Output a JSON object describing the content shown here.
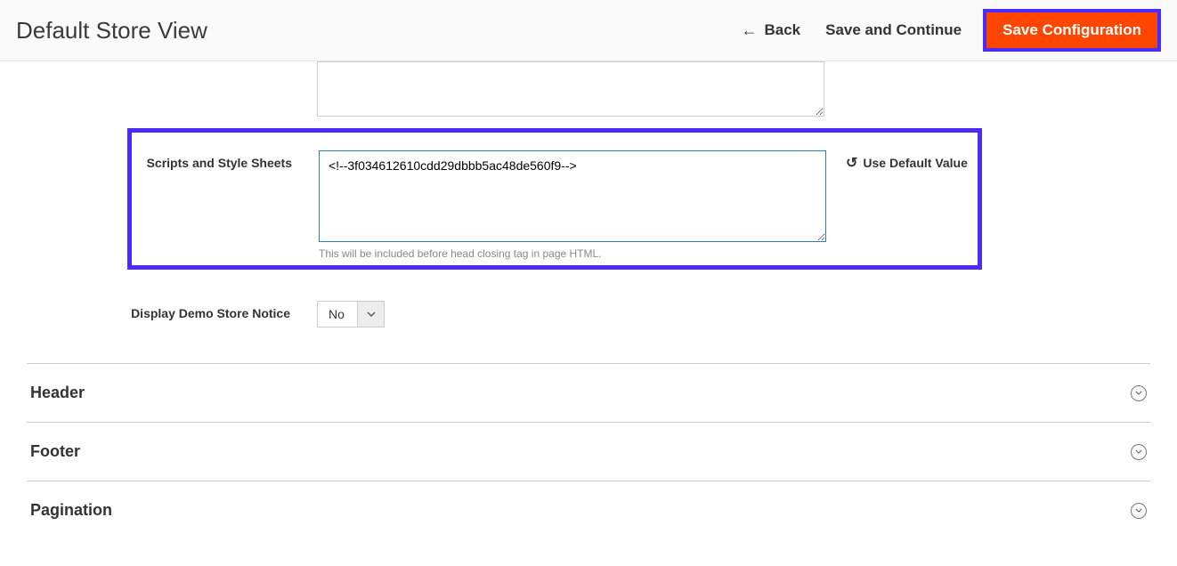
{
  "header": {
    "title": "Default Store View",
    "back_label": "Back",
    "save_continue_label": "Save and Continue",
    "save_config_label": "Save Configuration"
  },
  "fields": {
    "textarea_above_value": "",
    "scripts": {
      "label": "Scripts and Style Sheets",
      "value": "<!--3f034612610cdd29dbbb5ac48de560f9-->",
      "help": "This will be included before head closing tag in page HTML.",
      "use_default_label": "Use Default Value"
    },
    "demo_notice": {
      "label": "Display Demo Store Notice",
      "value": "No"
    }
  },
  "accordion": {
    "items": [
      {
        "label": "Header"
      },
      {
        "label": "Footer"
      },
      {
        "label": "Pagination"
      }
    ]
  }
}
